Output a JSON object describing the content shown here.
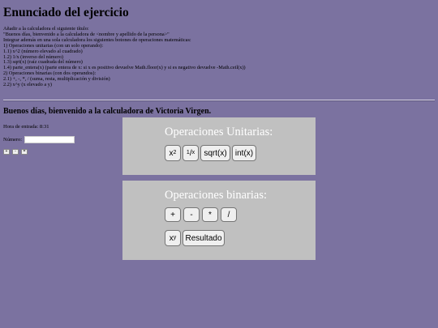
{
  "heading": "Enunciado del ejercicio",
  "instructions": [
    "Añadir a la calculadora el siguiente título:",
    "\"Buenos días, bienvenido a la calculadora de <nombre y apellido de la persona>\"",
    "Integrar además en una sola calculadora los siguientes botones de operaciones matemáticas:",
    "1) Operaciones unitarias (con un solo operando):",
    "1.1) x^2 (número elevado al cuadrado)",
    "1.2) 1/x (inverso del número)",
    "1.3) sqrt(x) (raíz cuadrada del número)",
    "1.4) parte_entera(x) (parte entera de x: si x es positivo devuelve Math.floor(x) y si es negativo devuelve -Math.ceil(x))",
    "2) Operaciones binarias (con dos operandos):",
    "2.1) +, -, *, / (suma, resta, multiplicación y división)",
    "2.2) x^y (x elevado a y)"
  ],
  "greeting": "Buenos días, bienvenido a la calculadora de Victoria Virgen.",
  "entry_time": "Hora de entrada: 8:31",
  "number_label": "Número:",
  "number_value": "",
  "mini_buttons": [
    "+",
    "-",
    "="
  ],
  "unary": {
    "title": "Operaciones Unitarias:",
    "square_base": "x",
    "square_exp": "2",
    "inverse_num": "1",
    "inverse_sep": "/",
    "inverse_den": "x",
    "sqrt": "sqrt(x)",
    "int": "int(x)"
  },
  "binary": {
    "title": "Operaciones binarias:",
    "ops": [
      "+",
      "-",
      "*",
      "/"
    ],
    "power_base": "x",
    "power_exp": "y",
    "result": "Resultado"
  }
}
